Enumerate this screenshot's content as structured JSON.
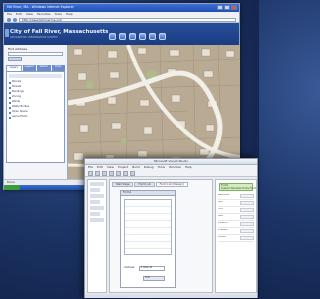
{
  "browser": {
    "title": "Fall River, MA - Windows Internet Explorer",
    "menu": [
      "File",
      "Edit",
      "View",
      "Favorites",
      "Tools",
      "Help"
    ],
    "address": "http://www.fallriverma.org/",
    "header": {
      "city": "City of Fall River, Massachusetts",
      "subtitle": "GEOGRAPHIC INFORMATION SYSTEM"
    },
    "sidebar": {
      "search_title": "Find Address",
      "tabs": [
        "Layers",
        "Legend",
        "Search",
        "Tools"
      ],
      "items": [
        "Parcels",
        "Streets",
        "Buildings",
        "Zoning",
        "Wards",
        "Water Bodies",
        "Open Space",
        "Aerial Photo"
      ]
    },
    "status": "Done"
  },
  "ide": {
    "title": "Microsoft Visual Studio",
    "menu": [
      "File",
      "Edit",
      "View",
      "Project",
      "Build",
      "Debug",
      "Tools",
      "Window",
      "Help"
    ],
    "tabs": [
      "Start Page",
      "Form1.vb",
      "Form1.vb [Design]"
    ],
    "form_caption": "Form1",
    "field_label": "Address",
    "field_value": "1 Main St",
    "button_label": "Find",
    "properties_selected": "Form1 System.Windows.Forms.Form",
    "properties": [
      "BackColor",
      "Text",
      "Font",
      "Size",
      "Location",
      "Enabled",
      "Visible"
    ]
  }
}
